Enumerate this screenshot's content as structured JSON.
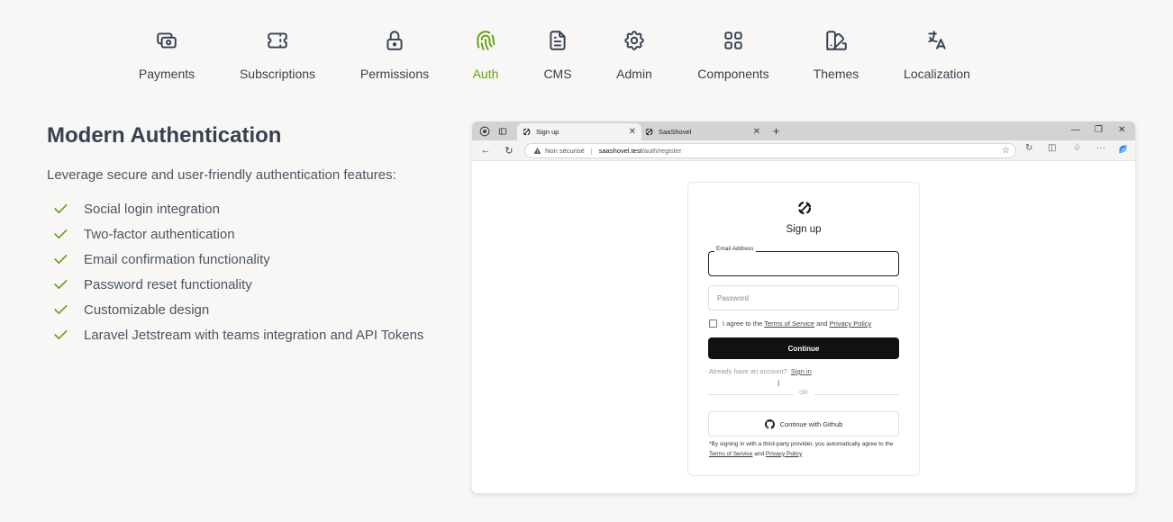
{
  "nav": {
    "items": [
      {
        "label": "Payments",
        "icon": "payments-icon",
        "active": false
      },
      {
        "label": "Subscriptions",
        "icon": "ticket-icon",
        "active": false
      },
      {
        "label": "Permissions",
        "icon": "lock-icon",
        "active": false
      },
      {
        "label": "Auth",
        "icon": "fingerprint-icon",
        "active": true
      },
      {
        "label": "CMS",
        "icon": "document-icon",
        "active": false
      },
      {
        "label": "Admin",
        "icon": "gear-icon",
        "active": false
      },
      {
        "label": "Components",
        "icon": "grid-icon",
        "active": false
      },
      {
        "label": "Themes",
        "icon": "palette-icon",
        "active": false
      },
      {
        "label": "Localization",
        "icon": "translate-icon",
        "active": false
      }
    ],
    "active_color": "#65a30d"
  },
  "feature": {
    "title": "Modern Authentication",
    "description": "Leverage secure and user-friendly authentication features:",
    "items": [
      "Social login integration",
      "Two-factor authentication",
      "Email confirmation functionality",
      "Password reset functionality",
      "Customizable design",
      "Laravel Jetstream with teams integration and API Tokens"
    ]
  },
  "browser": {
    "tabs": [
      {
        "title": "Sign up",
        "active": true
      },
      {
        "title": "SaaShovel",
        "active": false
      }
    ],
    "new_tab": "+",
    "security_label": "Non sécurisé",
    "url_host": "saashovel.test",
    "url_path": "/auth/register"
  },
  "signup": {
    "title": "Sign up",
    "email_label": "Email Address",
    "email_value": "",
    "password_placeholder": "Password",
    "agree_prefix": "I agree to the",
    "terms_link": "Terms of Service",
    "and_text": "and",
    "privacy_link": "Privacy Policy",
    "continue_label": "Continue",
    "have_account": "Already have an account?",
    "signin_link": "Sign in",
    "or_text": "OR",
    "github_label": "Continue with Github",
    "note_text": "*By signing in with a third-party provider, you automatically agree to the",
    "note_terms": "Terms of Service",
    "note_and": "and",
    "note_privacy": "Privacy Policy"
  }
}
